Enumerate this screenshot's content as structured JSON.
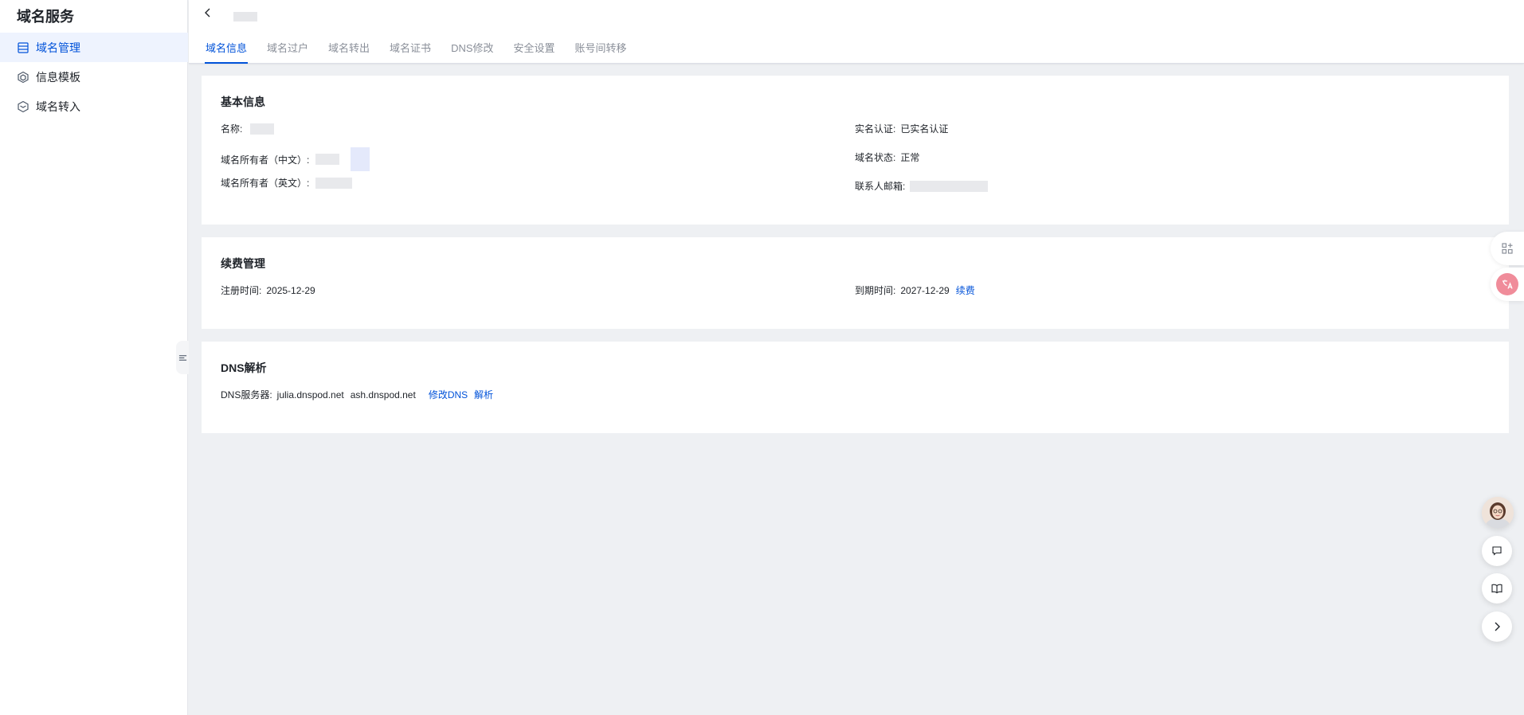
{
  "sidebar": {
    "title": "域名服务",
    "items": [
      {
        "label": "域名管理",
        "icon": "list-icon"
      },
      {
        "label": "信息模板",
        "icon": "cube-icon"
      },
      {
        "label": "域名转入",
        "icon": "layers-icon"
      }
    ]
  },
  "header": {
    "tabs": [
      "域名信息",
      "域名过户",
      "域名转出",
      "域名证书",
      "DNS修改",
      "安全设置",
      "账号间转移"
    ],
    "active_tab": 0
  },
  "basic_info": {
    "title": "基本信息",
    "name_label": "名称:",
    "owner_cn_label": "域名所有者（中文）:",
    "owner_en_label": "域名所有者（英文）:",
    "realname_label": "实名认证:",
    "realname_value": "已实名认证",
    "status_label": "域名状态:",
    "status_value": "正常",
    "email_label": "联系人邮箱:"
  },
  "renewal": {
    "title": "续费管理",
    "register_label": "注册时间:",
    "register_value": "2025-12-29",
    "expire_label": "到期时间:",
    "expire_value": "2027-12-29",
    "renew_link": "续费"
  },
  "dns": {
    "title": "DNS解析",
    "server_label": "DNS服务器:",
    "server1": "julia.dnspod.net",
    "server2": "ash.dnspod.net",
    "modify_link": "修改DNS",
    "resolve_link": "解析"
  },
  "colors": {
    "accent": "#0052d9",
    "background": "#eef0f3"
  }
}
